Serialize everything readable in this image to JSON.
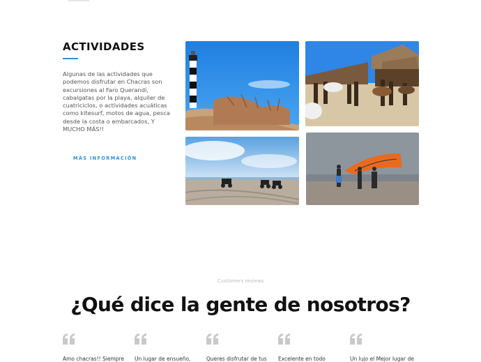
{
  "activities": {
    "title": "ACTIVIDADES",
    "description": "Algunas de las actividades que podemos disfrutar en Chacras son excursiones al Faro Querandí, cabalgatas por la playa, alquiler de cuatriciclos, o actividades acuáticas como kitesurf, motos de agua, pesca desde la costa o embarcados, Y MUCHO MÁS!!",
    "more_link": "MÁS INFORMACIÓN",
    "accent_color": "#2f8fd8"
  },
  "reviews": {
    "kicker": "Customers reviews",
    "title": "¿Qué dice la gente de nosotros?",
    "items": [
      {
        "text": "Amo chacras!! Siempre"
      },
      {
        "text": "Un lugar de ensueño,"
      },
      {
        "text": "Queres disfrutar de tus"
      },
      {
        "text": "Excelente en todo"
      },
      {
        "text": "Un lujo el Mejor lugar de"
      }
    ]
  }
}
